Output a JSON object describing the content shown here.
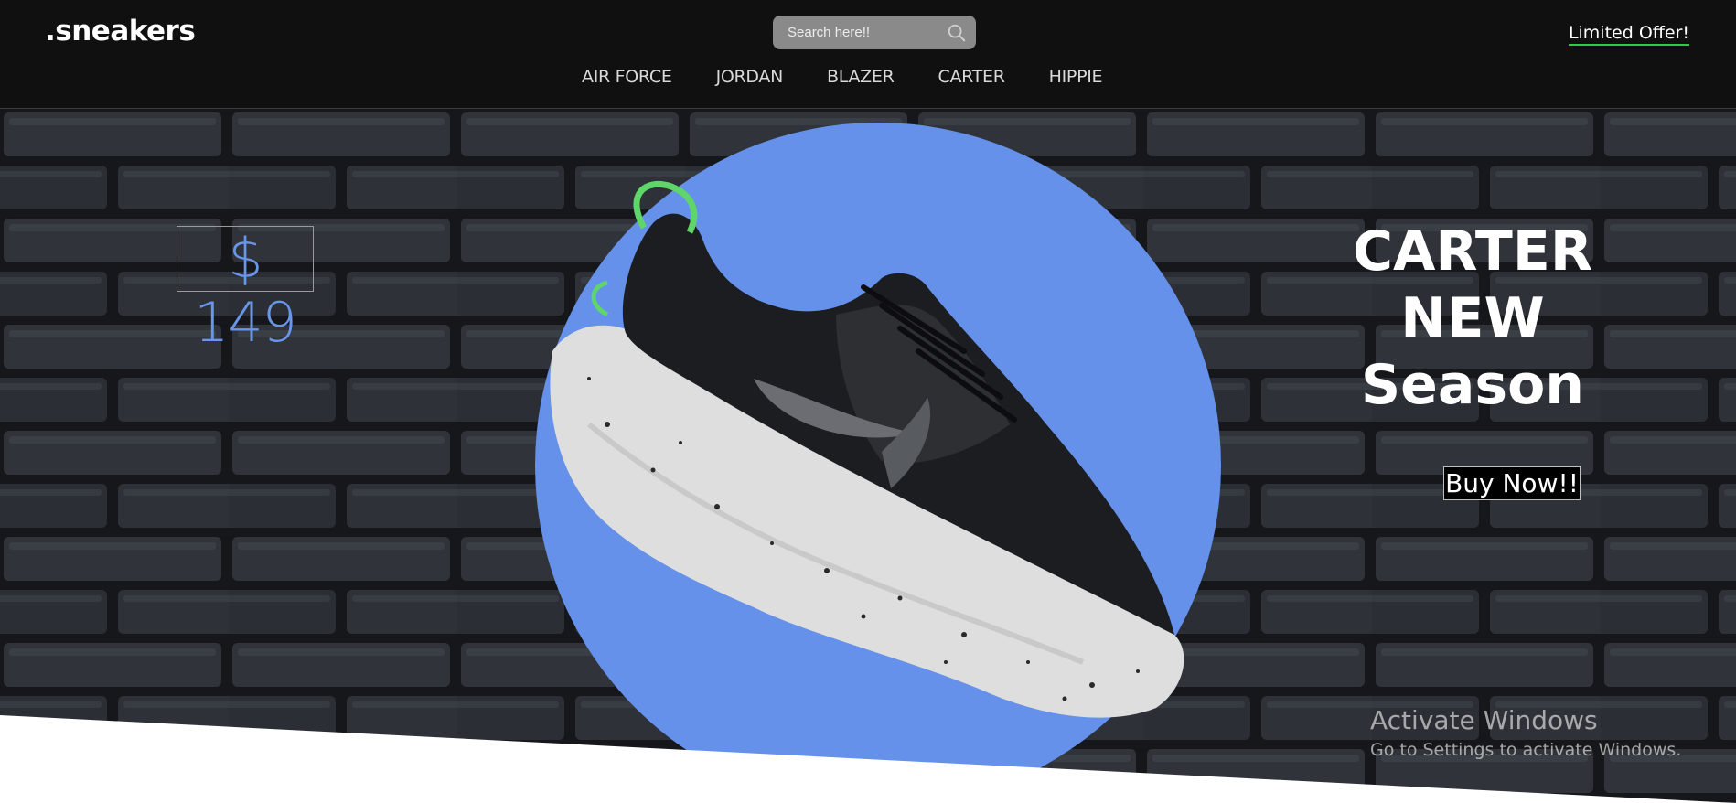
{
  "brand": {
    "logo": ".sneakers"
  },
  "search": {
    "placeholder": "Search here!!"
  },
  "nav": {
    "offer_link": "Limited Offer!",
    "items": [
      "AIR FORCE",
      "JORDAN",
      "BLAZER",
      "CARTER",
      "HIPPIE"
    ]
  },
  "hero": {
    "price": "$ 149",
    "headline_lines": [
      "CARTER",
      "NEW",
      "Season"
    ],
    "cta": "Buy Now!!"
  },
  "watermark": {
    "title": "Activate Windows",
    "subtitle": "Go to Settings to activate Windows."
  },
  "colors": {
    "navbar_bg": "#101010",
    "accent_blue": "#6591ea",
    "offer_underline": "#2ecc40",
    "price_text": "#6a96ea"
  },
  "icons": {
    "search": "search-icon"
  }
}
